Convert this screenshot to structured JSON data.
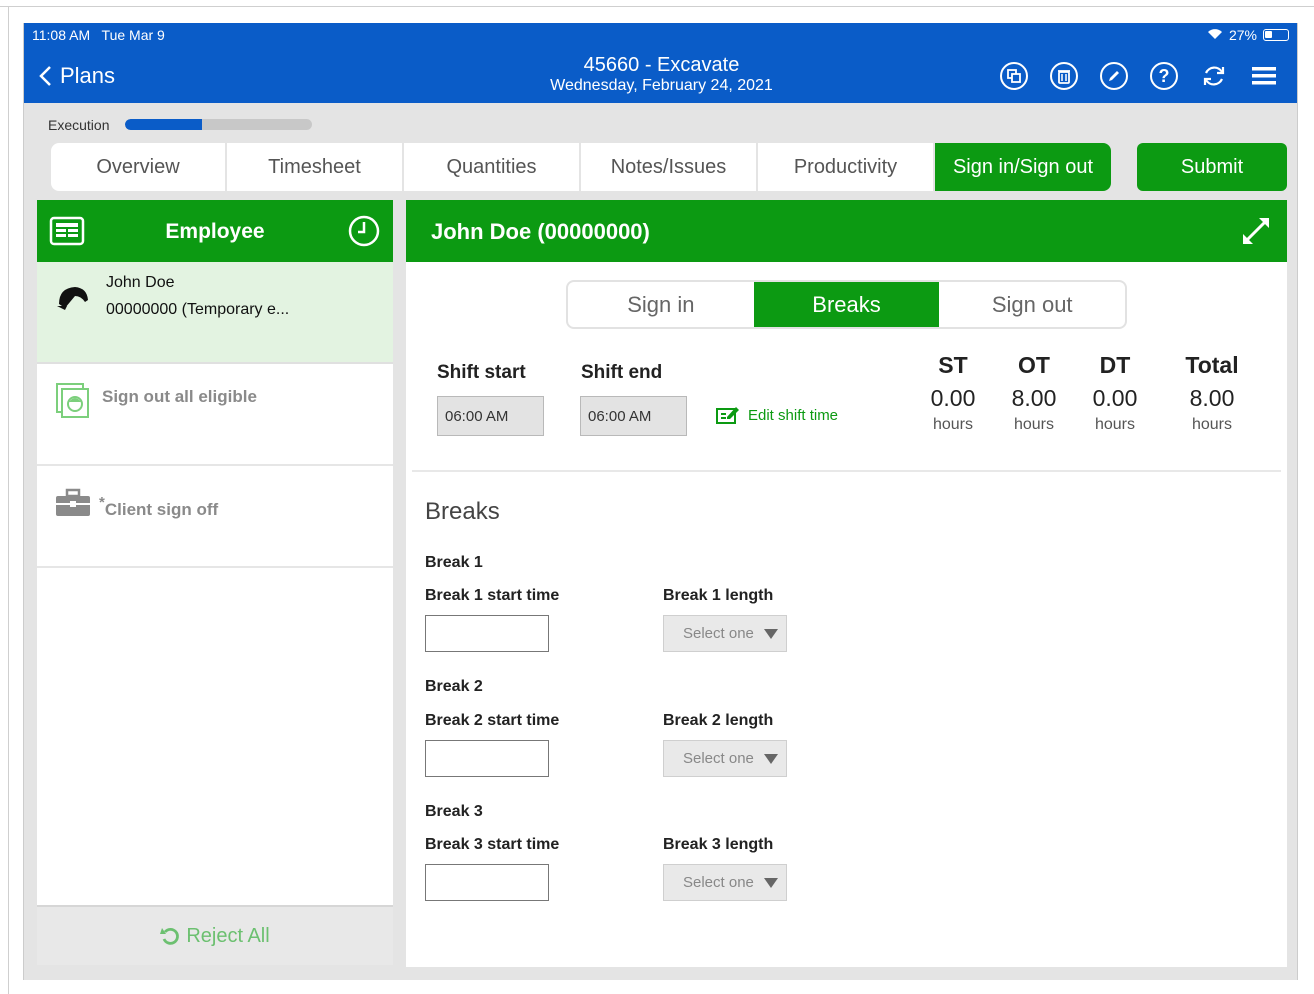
{
  "status": {
    "time": "11:08 AM",
    "date": "Tue Mar 9",
    "battery": "27%"
  },
  "header": {
    "back_label": "Plans",
    "title": "45660 - Excavate",
    "subtitle": "Wednesday, February 24, 2021",
    "icons": [
      "copy-icon",
      "delete-icon",
      "edit-icon",
      "help-icon",
      "refresh-icon",
      "menu-icon"
    ]
  },
  "execution": {
    "label": "Execution",
    "progress": 0.41
  },
  "tabs": [
    {
      "label": "Overview",
      "active": false
    },
    {
      "label": "Timesheet",
      "active": false
    },
    {
      "label": "Quantities",
      "active": false
    },
    {
      "label": "Notes/Issues",
      "active": false
    },
    {
      "label": "Productivity",
      "active": false
    },
    {
      "label": "Sign in/Sign out",
      "active": true
    }
  ],
  "submit_label": "Submit",
  "left_panel": {
    "title": "Employee",
    "employee": {
      "name": "John Doe",
      "id": "00000000 (Temporary e..."
    },
    "sign_out_all": "Sign out all eligible",
    "client_sign_off": "Client sign off",
    "client_sign_off_mark": "*",
    "reject_all": "Reject All"
  },
  "right_panel": {
    "title": "John Doe (00000000)",
    "segments": [
      {
        "label": "Sign in",
        "active": false
      },
      {
        "label": "Breaks",
        "active": true
      },
      {
        "label": "Sign out",
        "active": false
      }
    ],
    "shift_start_label": "Shift start",
    "shift_start_value": "06:00 AM",
    "shift_end_label": "Shift end",
    "shift_end_value": "06:00 AM",
    "edit_shift_label": "Edit shift time",
    "stats": [
      {
        "label": "ST",
        "value": "0.00",
        "unit": "hours"
      },
      {
        "label": "OT",
        "value": "8.00",
        "unit": "hours"
      },
      {
        "label": "DT",
        "value": "0.00",
        "unit": "hours"
      },
      {
        "label": "Total",
        "value": "8.00",
        "unit": "hours"
      }
    ],
    "breaks_title": "Breaks",
    "breaks": [
      {
        "name": "Break 1",
        "start_label": "Break 1 start time",
        "length_label": "Break 1 length",
        "start_value": "",
        "length_value": "Select one"
      },
      {
        "name": "Break 2",
        "start_label": "Break 2 start time",
        "length_label": "Break 2 length",
        "start_value": "",
        "length_value": "Select one"
      },
      {
        "name": "Break 3",
        "start_label": "Break 3 start time",
        "length_label": "Break 3 length",
        "start_value": "",
        "length_value": "Select one"
      }
    ]
  },
  "colors": {
    "brand_blue": "#0a5cc8",
    "accent_green": "#0c9a12",
    "selected_row": "#e3f3e1"
  }
}
